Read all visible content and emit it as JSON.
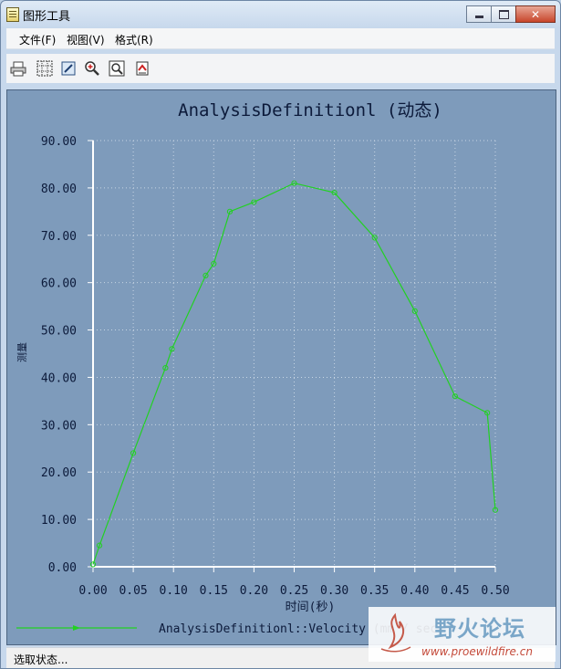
{
  "window": {
    "title": "图形工具",
    "min_icon": "minimize-icon",
    "max_icon": "maximize-icon",
    "close_label": "✕"
  },
  "menu": {
    "items": [
      "文件(F)",
      "视图(V)",
      "格式(R)"
    ]
  },
  "toolbar": {
    "icons": [
      "print-icon",
      "grid-icon",
      "edit-icon",
      "zoom-in-icon",
      "zoom-fit-icon",
      "export-icon"
    ]
  },
  "colors": {
    "plot_bg": "#7e9bbb",
    "series": "#22d122",
    "axis": "#ffffff",
    "grid": "#c8d6e4"
  },
  "chart_data": {
    "type": "line",
    "title": "AnalysisDefinitionl (动态)",
    "xlabel": "时间(秒)",
    "ylabel": "测量",
    "xlim": [
      0,
      0.5
    ],
    "ylim": [
      0,
      90
    ],
    "x_ticks": [
      "0.00",
      "0.05",
      "0.10",
      "0.15",
      "0.20",
      "0.25",
      "0.30",
      "0.35",
      "0.40",
      "0.45",
      "0.50"
    ],
    "y_ticks": [
      "0.00",
      "10.00",
      "20.00",
      "30.00",
      "40.00",
      "50.00",
      "60.00",
      "70.00",
      "80.00",
      "90.00"
    ],
    "grid": true,
    "legend_position": "bottom-left",
    "series": [
      {
        "name": "AnalysisDefinitionl::Velocity (mm / sec)",
        "x": [
          0.0,
          0.008,
          0.05,
          0.09,
          0.098,
          0.14,
          0.15,
          0.17,
          0.2,
          0.25,
          0.3,
          0.35,
          0.4,
          0.45,
          0.49,
          0.5
        ],
        "y": [
          0.5,
          4.5,
          24.0,
          42.0,
          46.0,
          61.5,
          64.0,
          75.0,
          77.0,
          81.0,
          79.0,
          69.5,
          54.0,
          36.0,
          32.5,
          12.0
        ]
      }
    ]
  },
  "status": {
    "text": "选取状态..."
  },
  "watermark": {
    "brand": "野火论坛",
    "url": "www.proewildfire.cn"
  }
}
